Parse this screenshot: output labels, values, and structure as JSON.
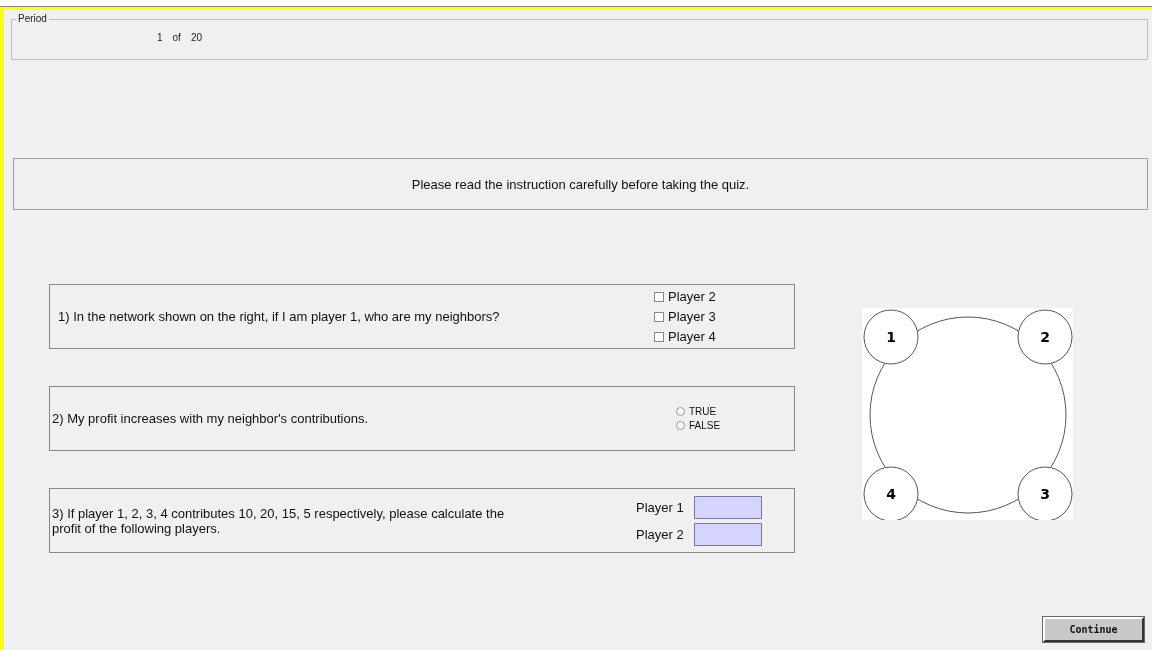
{
  "period": {
    "legend": "Period",
    "current": "1",
    "separator": "of",
    "total": "20"
  },
  "instruction": "Please read the instruction carefully before taking the quiz.",
  "questions": [
    {
      "kind": "checkboxes",
      "text": "1) In the network shown on the right, if I am player 1, who are my neighbors?",
      "options": [
        {
          "label": "Player 2",
          "checked": false
        },
        {
          "label": "Player 3",
          "checked": false
        },
        {
          "label": "Player 4",
          "checked": false
        }
      ]
    },
    {
      "kind": "radios",
      "text": "2) My profit increases with my neighbor's contributions.",
      "options": [
        {
          "label": "TRUE",
          "selected": false
        },
        {
          "label": "FALSE",
          "selected": false
        }
      ]
    },
    {
      "kind": "fields",
      "text": "3) If player 1, 2, 3, 4 contributes 10, 20, 15, 5 respectively, please calculate the profit of the following players.",
      "options": [
        {
          "label": "Player 1"
        },
        {
          "label": "Player 2"
        }
      ]
    }
  ],
  "network": {
    "nodes": [
      "1",
      "2",
      "4",
      "3"
    ]
  },
  "continue_button": "Continue"
}
